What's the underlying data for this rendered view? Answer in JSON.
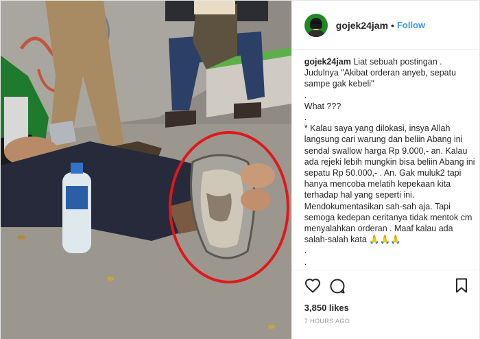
{
  "header": {
    "username": "gojek24jam",
    "separator": "•",
    "follow_label": "Follow"
  },
  "caption": {
    "username": "gojek24jam",
    "lines": [
      "Liat sebuah postingan .",
      "Judulnya \"Akibat orderan anyeb, sepatu sampe gak kebeli\"",
      ".",
      "What ???",
      ".",
      "* Kalau saya yang dilokasi, insya Allah langsung cari warung dan beliin Abang ini sendal swallow harga Rp 9.000,- an. Kalau ada rejeki lebih mungkin bisa beliin Abang ini sepatu Rp 50.000,- . An. Gak muluk2 tapi hanya mencoba melatih kepekaan kita terhadap hal yang seperti ini.",
      "Mendokumentasikan sah-sah aja. Tapi semoga kedepan ceritanya tidak mentok cm menyalahkan orderan . Maaf kalau ada salah-salah kata 🙏🙏🙏",
      ".",
      ".",
      "."
    ]
  },
  "actions": {
    "like_icon": "heart-icon",
    "comment_icon": "comment-icon",
    "bookmark_icon": "bookmark-icon"
  },
  "likes": "3,850 likes",
  "time": "7 HOURS AGO",
  "colors": {
    "follow_blue": "#3897f0",
    "annotation_red": "#e0181b",
    "gojek_green": "#1f8a25"
  }
}
